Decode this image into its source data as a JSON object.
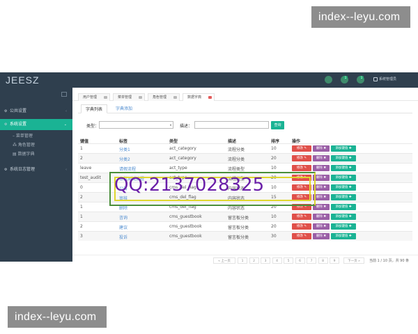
{
  "watermark": {
    "top": "index--leyu.com",
    "bottom": "index--leyu.com"
  },
  "overlay": {
    "qq_text": "QQ:2137028325"
  },
  "app": {
    "logo": "JEESZ",
    "topbar": {
      "badge1": "1",
      "badge2": "1",
      "user": "系统管理员"
    },
    "sidebar": {
      "items": [
        {
          "label": "公共设置",
          "icon": "gear-icon"
        },
        {
          "label": "系统设置",
          "icon": "cogs-icon"
        },
        {
          "label": "系统日志管理",
          "icon": "cogs-icon"
        }
      ],
      "sub_items": [
        {
          "label": "菜单管理"
        },
        {
          "label": "角色管理"
        },
        {
          "label": "数据字典"
        }
      ]
    },
    "tabs": [
      {
        "label": "用户管理"
      },
      {
        "label": "菜单管理"
      },
      {
        "label": "角色管理"
      },
      {
        "label": "数据字典"
      }
    ],
    "subtabs": {
      "list": "字典列表",
      "add": "字典添加"
    },
    "search": {
      "type_label": "类型：",
      "desc_label": "描述：",
      "query_button": "查询",
      "caret": "▾"
    },
    "table": {
      "headers": [
        "键值",
        "标签",
        "类型",
        "描述",
        "排序",
        "操作"
      ],
      "actions": {
        "edit": "修改 ✎",
        "del": "删除 ✖",
        "add": "添加键值 ✚"
      },
      "rows": [
        [
          "1",
          "分类1",
          "act_category",
          "流程分类",
          "10"
        ],
        [
          "2",
          "分类2",
          "act_category",
          "流程分类",
          "20"
        ],
        [
          "leave",
          "请假流程",
          "act_type",
          "流程类型",
          "10"
        ],
        [
          "test_audit",
          "审批测试流程",
          "act_type",
          "流程类型",
          "20"
        ],
        [
          "0",
          "公告",
          "cms_del_flag",
          "内容状态",
          "10"
        ],
        [
          "2",
          "审核",
          "cms_del_flag",
          "内容状态",
          "15"
        ],
        [
          "1",
          "删除",
          "cms_del_flag",
          "内容状态",
          "20"
        ],
        [
          "1",
          "咨询",
          "cms_guestbook",
          "留言板分类",
          "10"
        ],
        [
          "2",
          "建议",
          "cms_guestbook",
          "留言板分类",
          "20"
        ],
        [
          "3",
          "投诉",
          "cms_guestbook",
          "留言板分类",
          "30"
        ]
      ]
    },
    "pager": {
      "prev": "« 上一页",
      "pages": [
        "1",
        "2",
        "3",
        "4",
        "5",
        "6",
        "7",
        "8",
        "9"
      ],
      "next": "下一页 »",
      "info": "当前 1 / 10 页，共 90 条"
    }
  }
}
